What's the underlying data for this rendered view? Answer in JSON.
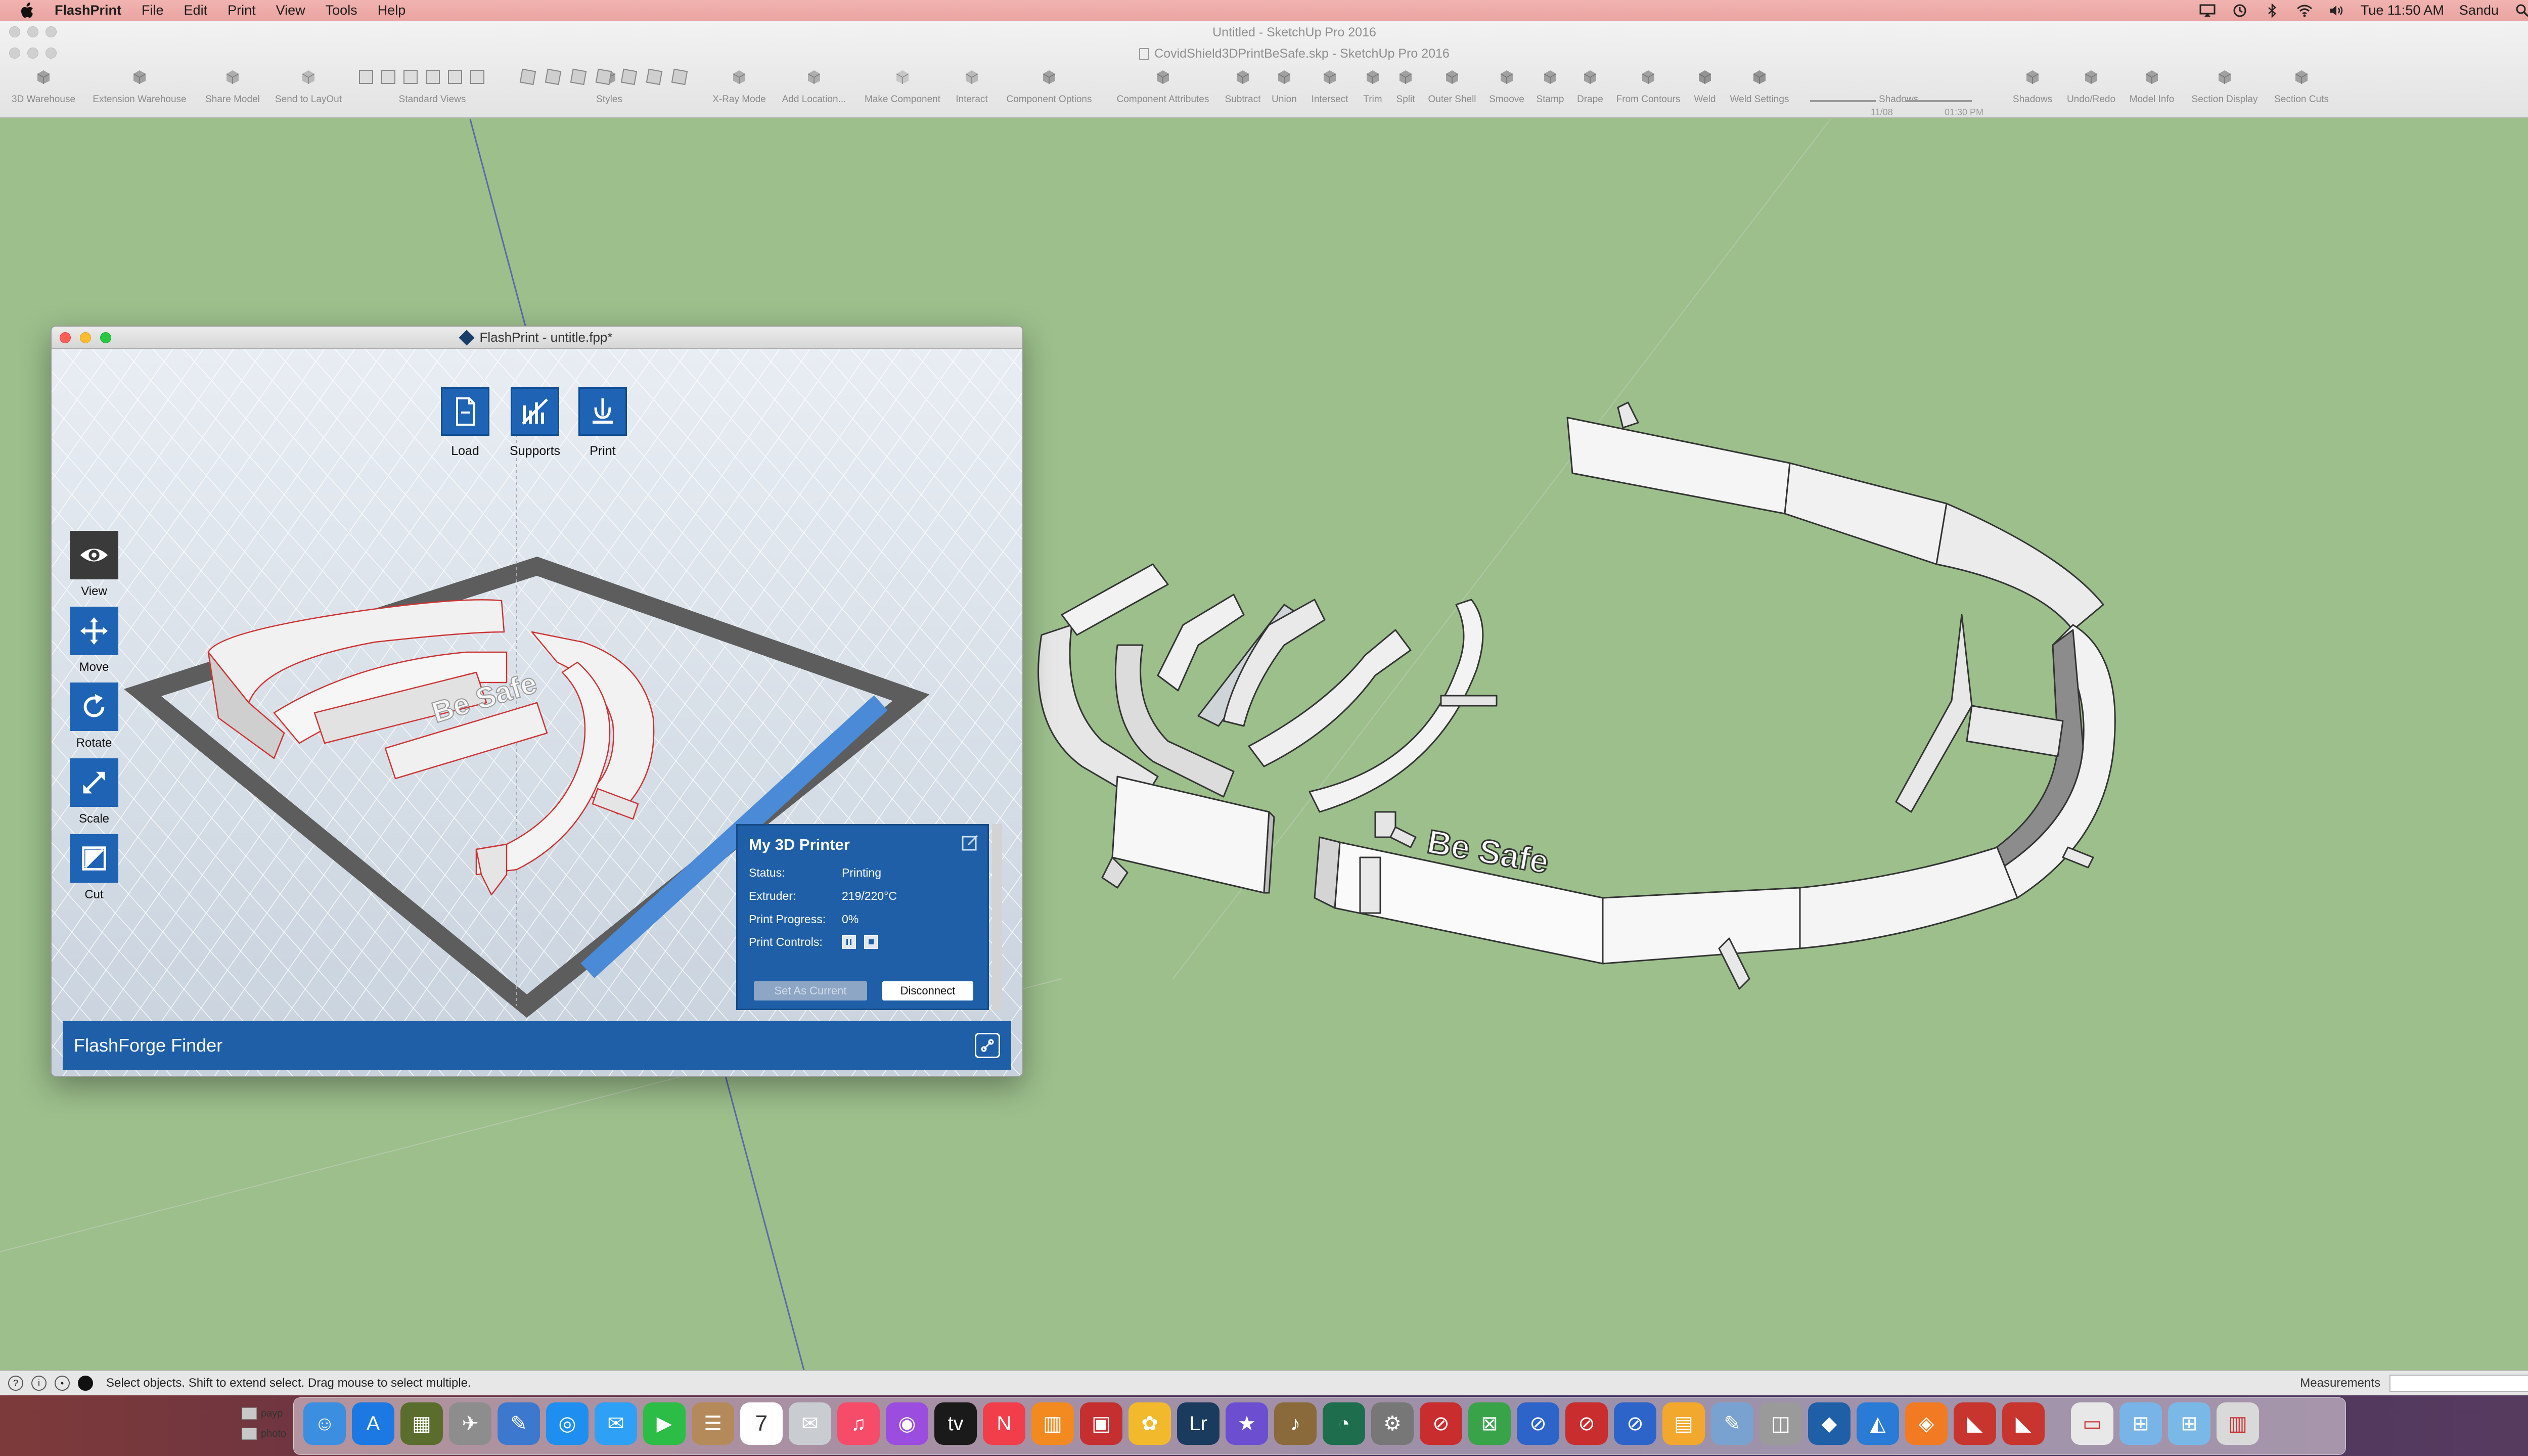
{
  "menubar": {
    "app_name": "FlashPrint",
    "menus": [
      "File",
      "Edit",
      "Print",
      "View",
      "Tools",
      "Help"
    ],
    "clock": "Tue 11:50 AM",
    "user": "Sandu"
  },
  "sketchup": {
    "title_untitled": "Untitled - SketchUp Pro 2016",
    "title_document": "CovidShield3DPrintBeSafe.skp - SketchUp Pro 2016",
    "toolbar": [
      {
        "label": "3D Warehouse",
        "icon": "warehouse-icon"
      },
      {
        "label": "Extension Warehouse",
        "icon": "extension-icon"
      },
      {
        "label": "Share Model",
        "icon": "share-icon"
      },
      {
        "label": "Send to LayOut",
        "icon": "layout-icon"
      },
      {
        "label": "Standard Views",
        "icon": "views-icon"
      },
      {
        "label": "Styles",
        "icon": "styles-icon"
      },
      {
        "label": "X-Ray Mode",
        "icon": "xray-icon"
      },
      {
        "label": "Add Location...",
        "icon": "location-icon"
      },
      {
        "label": "Make Component",
        "icon": "component-icon"
      },
      {
        "label": "Interact",
        "icon": "interact-icon"
      },
      {
        "label": "Component Options",
        "icon": "options-icon"
      },
      {
        "label": "Component Attributes",
        "icon": "attributes-icon"
      },
      {
        "label": "Subtract",
        "icon": "subtract-icon"
      },
      {
        "label": "Union",
        "icon": "union-icon"
      },
      {
        "label": "Intersect",
        "icon": "intersect-icon"
      },
      {
        "label": "Trim",
        "icon": "trim-icon"
      },
      {
        "label": "Split",
        "icon": "split-icon"
      },
      {
        "label": "Outer Shell",
        "icon": "shell-icon"
      },
      {
        "label": "Smoove",
        "icon": "smoove-icon"
      },
      {
        "label": "Stamp",
        "icon": "stamp-icon"
      },
      {
        "label": "Drape",
        "icon": "drape-icon"
      },
      {
        "label": "From Contours",
        "icon": "contours-icon"
      },
      {
        "label": "Weld",
        "icon": "weld-icon"
      },
      {
        "label": "Weld Settings",
        "icon": "weld-settings-icon"
      },
      {
        "label": "Shadows",
        "icon": "shadows-icon"
      },
      {
        "label": "Shadows",
        "icon": "shadows-toggle-icon"
      },
      {
        "label": "Undo/Redo",
        "icon": "undo-redo-icon"
      },
      {
        "label": "Model Info",
        "icon": "model-info-icon"
      },
      {
        "label": "Section Display",
        "icon": "section-display-icon"
      },
      {
        "label": "Section Cuts",
        "icon": "section-cuts-icon"
      }
    ],
    "shadow_date": "11/08",
    "shadow_time": "01:30 PM",
    "status_hint": "Select objects. Shift to extend select. Drag mouse to select multiple.",
    "measurements_label": "Measurements",
    "model_text": "Be Safe"
  },
  "flashprint": {
    "title": "FlashPrint - untitle.fpp*",
    "top_buttons": [
      "Load",
      "Supports",
      "Print"
    ],
    "side_buttons": [
      "View",
      "Move",
      "Rotate",
      "Scale",
      "Cut"
    ],
    "model_text": "Be Safe",
    "printer": {
      "name": "My 3D Printer",
      "status_label": "Status:",
      "status_value": "Printing",
      "extruder_label": "Extruder:",
      "extruder_value": "219/220°C",
      "progress_label": "Print Progress:",
      "progress_value": "0%",
      "controls_label": "Print Controls:",
      "set_current": "Set As Current",
      "disconnect": "Disconnect"
    },
    "footer_name": "FlashForge Finder"
  },
  "dock": {
    "folder_items": [
      "payp",
      "photo"
    ],
    "apps": [
      "Finder",
      "App Store",
      "Mission Control",
      "Launchpad",
      "Preview",
      "Safari",
      "Messages",
      "FaceTime",
      "Contacts",
      "Calendar",
      "Preview",
      "Music",
      "Podcasts",
      "TV",
      "News",
      "Books",
      "Photo Booth",
      "Photos",
      "Lightroom",
      "iMovie",
      "Instruments",
      "Time Machine",
      "System Preferences",
      "App1",
      "App2",
      "App3",
      "App4",
      "App5",
      "Pages",
      "Script Editor",
      "Disk Utility",
      "FlashPrint",
      "Xcode",
      "Blender",
      "SketchUp",
      "SketchUp 2",
      "Downloads",
      "Applications",
      "Documents",
      "Trash"
    ],
    "calendar_day": "7"
  }
}
